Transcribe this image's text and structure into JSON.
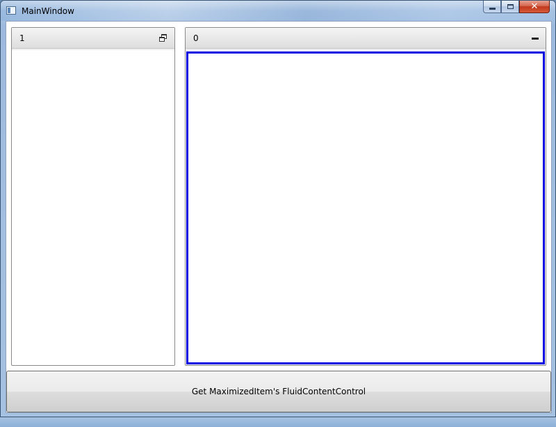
{
  "window": {
    "title": "MainWindow",
    "icon": "app-window-icon",
    "caption_buttons": [
      "minimize-icon",
      "maximize-icon",
      "close-icon"
    ],
    "close_label": "✕"
  },
  "panels": {
    "left": {
      "title": "1",
      "state_icon": "restore-icon"
    },
    "right": {
      "title": "0",
      "state_icon": "minimize-icon",
      "content_border_color": "#0000e0"
    }
  },
  "action_button": {
    "label": "Get MaximizedItem's FluidContentControl"
  }
}
